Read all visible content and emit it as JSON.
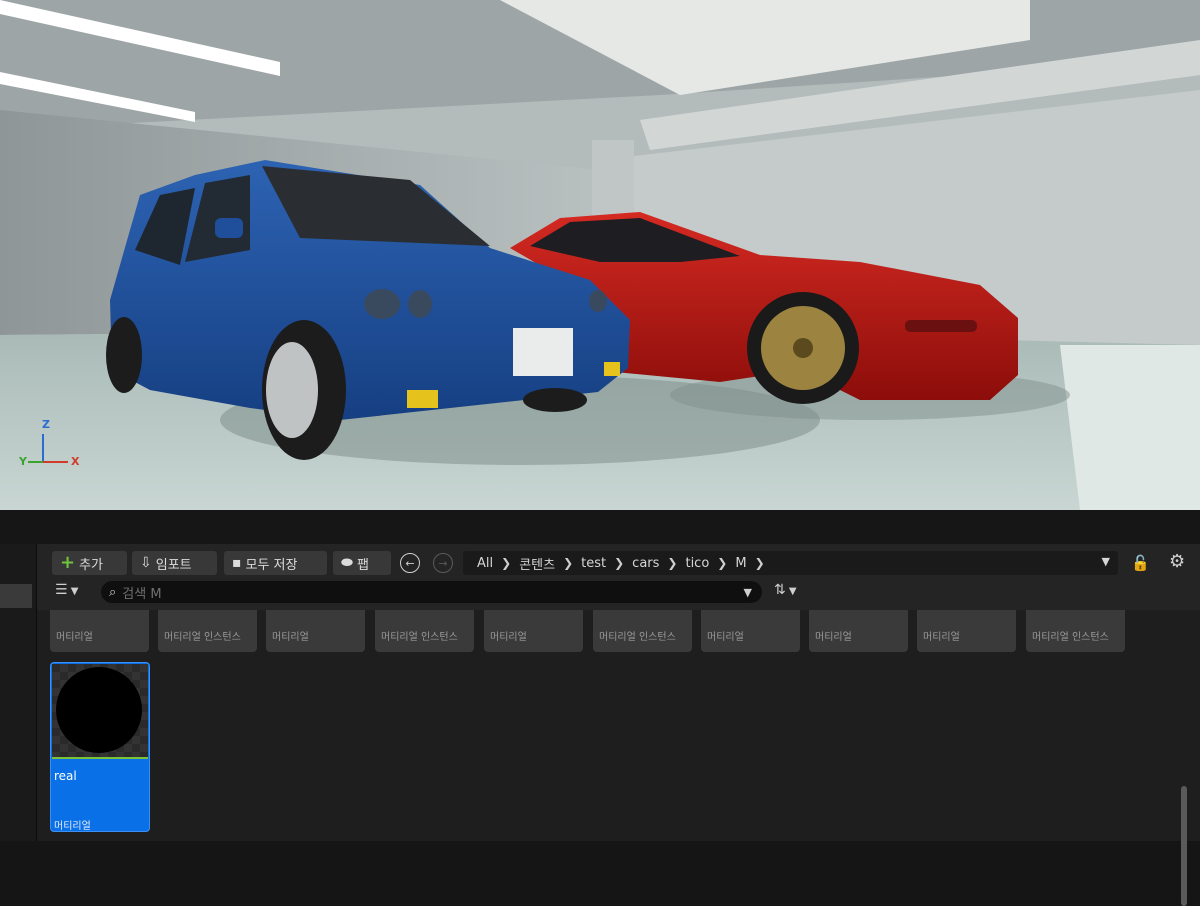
{
  "viewport": {
    "gizmo": {
      "z_label": "Z",
      "y_label": "Y",
      "x_label": "X"
    }
  },
  "toolbar": {
    "add_label": "추가",
    "import_label": "임포트",
    "save_all_label": "모두 저장",
    "fab_label": "팹"
  },
  "breadcrumb": {
    "items": [
      "All",
      "콘텐츠",
      "test",
      "cars",
      "tico",
      "M"
    ]
  },
  "search": {
    "placeholder": "검색 M"
  },
  "assets": {
    "row_types": [
      "머티리얼",
      "머티리얼 인스턴스",
      "머티리얼",
      "머티리얼 인스턴스",
      "머티리얼",
      "머티리얼 인스턴스",
      "머티리얼",
      "머티리얼",
      "머티리얼",
      "머티리얼 인스턴스"
    ],
    "selected": {
      "name": "real",
      "type": "머티리얼"
    }
  },
  "colors": {
    "selection": "#0a70e8",
    "background": "#242424",
    "add_icon": "#6fc33d",
    "blue_car": "#1f4f9a",
    "red_car": "#b5120e"
  },
  "icons": [
    "plus-icon",
    "import-icon",
    "save-icon",
    "fab-icon",
    "back-icon",
    "forward-icon",
    "chevron-right-icon",
    "chevron-down-icon",
    "lock-icon",
    "gear-icon",
    "filter-icon",
    "search-icon",
    "sort-icon"
  ]
}
